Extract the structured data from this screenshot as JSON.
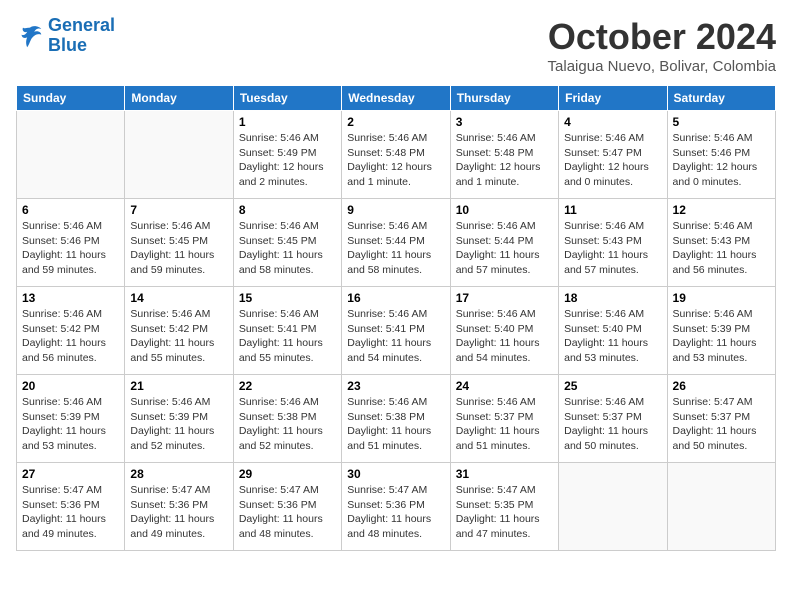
{
  "logo": {
    "line1": "General",
    "line2": "Blue"
  },
  "title": "October 2024",
  "location": "Talaigua Nuevo, Bolivar, Colombia",
  "days_of_week": [
    "Sunday",
    "Monday",
    "Tuesday",
    "Wednesday",
    "Thursday",
    "Friday",
    "Saturday"
  ],
  "weeks": [
    [
      {
        "day": "",
        "info": ""
      },
      {
        "day": "",
        "info": ""
      },
      {
        "day": "1",
        "info": "Sunrise: 5:46 AM\nSunset: 5:49 PM\nDaylight: 12 hours\nand 2 minutes."
      },
      {
        "day": "2",
        "info": "Sunrise: 5:46 AM\nSunset: 5:48 PM\nDaylight: 12 hours\nand 1 minute."
      },
      {
        "day": "3",
        "info": "Sunrise: 5:46 AM\nSunset: 5:48 PM\nDaylight: 12 hours\nand 1 minute."
      },
      {
        "day": "4",
        "info": "Sunrise: 5:46 AM\nSunset: 5:47 PM\nDaylight: 12 hours\nand 0 minutes."
      },
      {
        "day": "5",
        "info": "Sunrise: 5:46 AM\nSunset: 5:46 PM\nDaylight: 12 hours\nand 0 minutes."
      }
    ],
    [
      {
        "day": "6",
        "info": "Sunrise: 5:46 AM\nSunset: 5:46 PM\nDaylight: 11 hours\nand 59 minutes."
      },
      {
        "day": "7",
        "info": "Sunrise: 5:46 AM\nSunset: 5:45 PM\nDaylight: 11 hours\nand 59 minutes."
      },
      {
        "day": "8",
        "info": "Sunrise: 5:46 AM\nSunset: 5:45 PM\nDaylight: 11 hours\nand 58 minutes."
      },
      {
        "day": "9",
        "info": "Sunrise: 5:46 AM\nSunset: 5:44 PM\nDaylight: 11 hours\nand 58 minutes."
      },
      {
        "day": "10",
        "info": "Sunrise: 5:46 AM\nSunset: 5:44 PM\nDaylight: 11 hours\nand 57 minutes."
      },
      {
        "day": "11",
        "info": "Sunrise: 5:46 AM\nSunset: 5:43 PM\nDaylight: 11 hours\nand 57 minutes."
      },
      {
        "day": "12",
        "info": "Sunrise: 5:46 AM\nSunset: 5:43 PM\nDaylight: 11 hours\nand 56 minutes."
      }
    ],
    [
      {
        "day": "13",
        "info": "Sunrise: 5:46 AM\nSunset: 5:42 PM\nDaylight: 11 hours\nand 56 minutes."
      },
      {
        "day": "14",
        "info": "Sunrise: 5:46 AM\nSunset: 5:42 PM\nDaylight: 11 hours\nand 55 minutes."
      },
      {
        "day": "15",
        "info": "Sunrise: 5:46 AM\nSunset: 5:41 PM\nDaylight: 11 hours\nand 55 minutes."
      },
      {
        "day": "16",
        "info": "Sunrise: 5:46 AM\nSunset: 5:41 PM\nDaylight: 11 hours\nand 54 minutes."
      },
      {
        "day": "17",
        "info": "Sunrise: 5:46 AM\nSunset: 5:40 PM\nDaylight: 11 hours\nand 54 minutes."
      },
      {
        "day": "18",
        "info": "Sunrise: 5:46 AM\nSunset: 5:40 PM\nDaylight: 11 hours\nand 53 minutes."
      },
      {
        "day": "19",
        "info": "Sunrise: 5:46 AM\nSunset: 5:39 PM\nDaylight: 11 hours\nand 53 minutes."
      }
    ],
    [
      {
        "day": "20",
        "info": "Sunrise: 5:46 AM\nSunset: 5:39 PM\nDaylight: 11 hours\nand 53 minutes."
      },
      {
        "day": "21",
        "info": "Sunrise: 5:46 AM\nSunset: 5:39 PM\nDaylight: 11 hours\nand 52 minutes."
      },
      {
        "day": "22",
        "info": "Sunrise: 5:46 AM\nSunset: 5:38 PM\nDaylight: 11 hours\nand 52 minutes."
      },
      {
        "day": "23",
        "info": "Sunrise: 5:46 AM\nSunset: 5:38 PM\nDaylight: 11 hours\nand 51 minutes."
      },
      {
        "day": "24",
        "info": "Sunrise: 5:46 AM\nSunset: 5:37 PM\nDaylight: 11 hours\nand 51 minutes."
      },
      {
        "day": "25",
        "info": "Sunrise: 5:46 AM\nSunset: 5:37 PM\nDaylight: 11 hours\nand 50 minutes."
      },
      {
        "day": "26",
        "info": "Sunrise: 5:47 AM\nSunset: 5:37 PM\nDaylight: 11 hours\nand 50 minutes."
      }
    ],
    [
      {
        "day": "27",
        "info": "Sunrise: 5:47 AM\nSunset: 5:36 PM\nDaylight: 11 hours\nand 49 minutes."
      },
      {
        "day": "28",
        "info": "Sunrise: 5:47 AM\nSunset: 5:36 PM\nDaylight: 11 hours\nand 49 minutes."
      },
      {
        "day": "29",
        "info": "Sunrise: 5:47 AM\nSunset: 5:36 PM\nDaylight: 11 hours\nand 48 minutes."
      },
      {
        "day": "30",
        "info": "Sunrise: 5:47 AM\nSunset: 5:36 PM\nDaylight: 11 hours\nand 48 minutes."
      },
      {
        "day": "31",
        "info": "Sunrise: 5:47 AM\nSunset: 5:35 PM\nDaylight: 11 hours\nand 47 minutes."
      },
      {
        "day": "",
        "info": ""
      },
      {
        "day": "",
        "info": ""
      }
    ]
  ]
}
